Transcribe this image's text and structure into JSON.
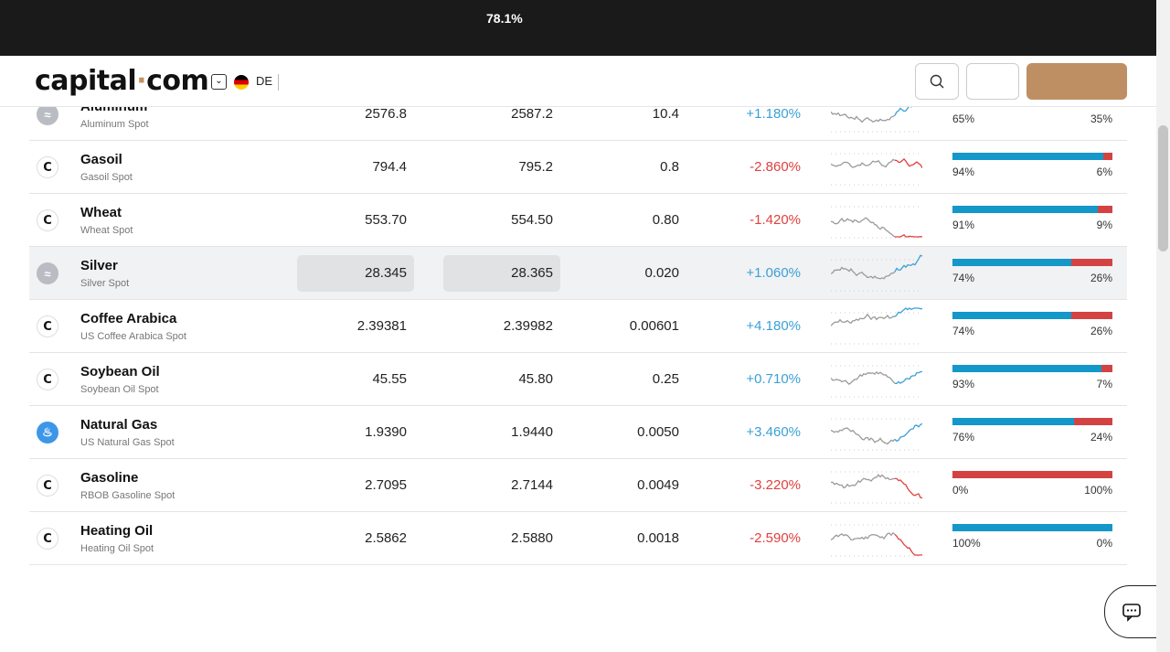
{
  "topbar": {
    "percent": "78.1%"
  },
  "header": {
    "logo_main": "capital",
    "logo_dot": "·",
    "logo_end": "com",
    "lang_code": "DE"
  },
  "rows": [
    {
      "name": "Aluminum",
      "sub": "Aluminum Spot",
      "icon": "aluminum-icon",
      "sell": "2576.8",
      "buy": "2587.2",
      "spread": "10.4",
      "change": "+1.180%",
      "dir": "up",
      "buyers_pct": "65%",
      "sellers_pct": "35%",
      "buyers": 65
    },
    {
      "name": "Gasoil",
      "sub": "Gasoil Spot",
      "icon": "capital-c-icon",
      "sell": "794.4",
      "buy": "795.2",
      "spread": "0.8",
      "change": "-2.860%",
      "dir": "down",
      "buyers_pct": "94%",
      "sellers_pct": "6%",
      "buyers": 94
    },
    {
      "name": "Wheat",
      "sub": "Wheat Spot",
      "icon": "capital-c-icon",
      "sell": "553.70",
      "buy": "554.50",
      "spread": "0.80",
      "change": "-1.420%",
      "dir": "down",
      "buyers_pct": "91%",
      "sellers_pct": "9%",
      "buyers": 91
    },
    {
      "name": "Silver",
      "sub": "Silver Spot",
      "icon": "silver-icon",
      "sell": "28.345",
      "buy": "28.365",
      "spread": "0.020",
      "change": "+1.060%",
      "dir": "up",
      "buyers_pct": "74%",
      "sellers_pct": "26%",
      "buyers": 74,
      "highlight": true
    },
    {
      "name": "Coffee Arabica",
      "sub": "US Coffee Arabica Spot",
      "icon": "capital-c-icon",
      "sell": "2.39381",
      "buy": "2.39982",
      "spread": "0.00601",
      "change": "+4.180%",
      "dir": "up",
      "buyers_pct": "74%",
      "sellers_pct": "26%",
      "buyers": 74
    },
    {
      "name": "Soybean Oil",
      "sub": "Soybean Oil Spot",
      "icon": "capital-c-icon",
      "sell": "45.55",
      "buy": "45.80",
      "spread": "0.25",
      "change": "+0.710%",
      "dir": "up",
      "buyers_pct": "93%",
      "sellers_pct": "7%",
      "buyers": 93
    },
    {
      "name": "Natural Gas",
      "sub": "US Natural Gas Spot",
      "icon": "flame-icon",
      "sell": "1.9390",
      "buy": "1.9440",
      "spread": "0.0050",
      "change": "+3.460%",
      "dir": "up",
      "buyers_pct": "76%",
      "sellers_pct": "24%",
      "buyers": 76
    },
    {
      "name": "Gasoline",
      "sub": "RBOB Gasoline Spot",
      "icon": "capital-c-icon",
      "sell": "2.7095",
      "buy": "2.7144",
      "spread": "0.0049",
      "change": "-3.220%",
      "dir": "down",
      "buyers_pct": "0%",
      "sellers_pct": "100%",
      "buyers": 0
    },
    {
      "name": "Heating Oil",
      "sub": "Heating Oil Spot",
      "icon": "capital-c-icon",
      "sell": "2.5862",
      "buy": "2.5880",
      "spread": "0.0018",
      "change": "-2.590%",
      "dir": "down",
      "buyers_pct": "100%",
      "sellers_pct": "0%",
      "buyers": 100
    }
  ],
  "colors": {
    "up": "#3aa0d6",
    "down": "#e0403e",
    "buyers": "#1497c9",
    "sellers": "#d44343",
    "brand": "#bf8f64"
  }
}
